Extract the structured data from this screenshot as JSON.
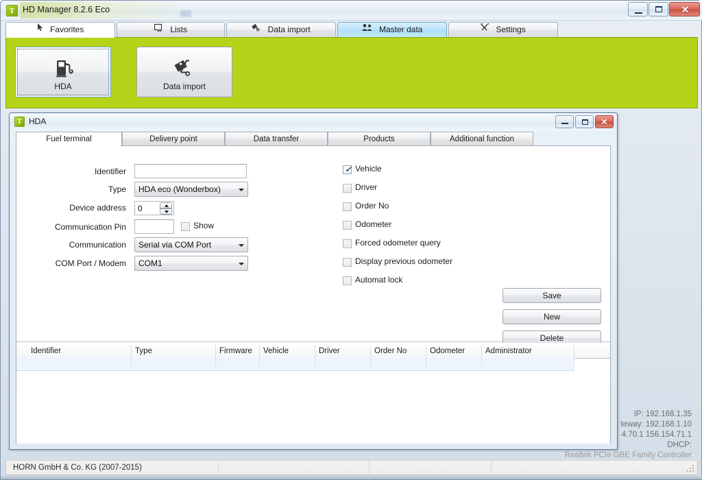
{
  "window": {
    "title": "HD Manager 8.2.6  Eco",
    "icon": "app-logo-icon",
    "controls": {
      "minimize": "minimize-icon",
      "maximize": "maximize-icon",
      "close": "✕"
    }
  },
  "main_tabs": [
    {
      "label": "Favorites",
      "icon": "cursor-icon",
      "state": "active"
    },
    {
      "label": "Lists",
      "icon": "list-icon",
      "state": "normal"
    },
    {
      "label": "Data import",
      "icon": "import-icon",
      "state": "normal"
    },
    {
      "label": "Master data",
      "icon": "people-icon",
      "state": "highlight"
    },
    {
      "label": "Settings",
      "icon": "tools-icon",
      "state": "normal"
    }
  ],
  "favorites": {
    "background_color": "#b5d319",
    "buttons": [
      {
        "label": "HDA",
        "icon": "fuel-pump-icon",
        "focused": true
      },
      {
        "label": "Data import",
        "icon": "hand-truck-icon",
        "focused": false
      }
    ]
  },
  "hda_window": {
    "title": "HDA",
    "icon": "app-logo-icon",
    "controls": {
      "minimize": "minimize-icon",
      "maximize": "maximize-icon",
      "close": "✕"
    },
    "tabs": [
      {
        "label": "Fuel terminal",
        "state": "active"
      },
      {
        "label": "Delivery point",
        "state": "normal"
      },
      {
        "label": "Data transfer",
        "state": "normal"
      },
      {
        "label": "Products",
        "state": "normal"
      },
      {
        "label": "Additional function",
        "state": "normal"
      }
    ],
    "form": {
      "fields": [
        {
          "label": "Identifier",
          "type": "text",
          "value": "",
          "placeholder": ""
        },
        {
          "label": "Type",
          "type": "combo",
          "value": "HDA eco  (Wonderbox)"
        },
        {
          "label": "Device address",
          "type": "spinner",
          "value": "0"
        },
        {
          "label": "Communication Pin",
          "type": "password",
          "value": "",
          "placeholder": ""
        },
        {
          "label": "Communication",
          "type": "combo",
          "value": "Serial via COM Port"
        },
        {
          "label": "COM Port / Modem",
          "type": "combo",
          "value": "COM1"
        }
      ],
      "show_pin": {
        "label": "Show",
        "checked": false
      },
      "checkboxes": [
        {
          "label": "Vehicle",
          "checked": true
        },
        {
          "label": "Driver",
          "checked": false
        },
        {
          "label": "Order No",
          "checked": false
        },
        {
          "label": "Odometer",
          "checked": false
        },
        {
          "label": "Forced odometer query",
          "checked": false
        },
        {
          "label": "Display previous odometer",
          "checked": false
        },
        {
          "label": "Automat lock",
          "checked": false
        }
      ],
      "actions": [
        {
          "label": "Save"
        },
        {
          "label": "New"
        },
        {
          "label": "Delete"
        }
      ]
    },
    "grid": {
      "columns": [
        "Identifier",
        "Type",
        "Firmware",
        "Vehicle",
        "Driver",
        "Order No",
        "Odometer",
        "Administrator"
      ],
      "rows": [
        {
          "Identifier": "",
          "Type": "",
          "Firmware": "",
          "Vehicle": "",
          "Driver": "",
          "Order No": "",
          "Odometer": "",
          "Administrator": ""
        }
      ]
    }
  },
  "network_info": {
    "ip": "IP: 192.168.1.35",
    "gateway": "teway: 192.168.1.10",
    "dns": "4.70.1 156.154.71.1",
    "dhcp": "DHCP:",
    "adapter": "Realtek PCIe GBE Family Controller"
  },
  "status_bar": {
    "panels": [
      "HORN GmbH & Co. KG (2007-2015)",
      "",
      "",
      ""
    ]
  }
}
